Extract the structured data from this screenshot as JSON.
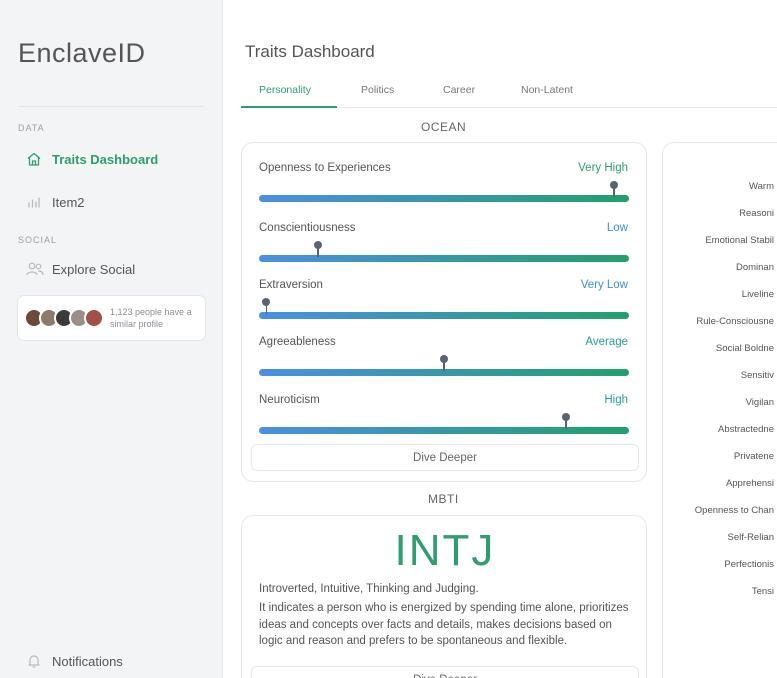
{
  "app": {
    "brand": "EnclaveID"
  },
  "sidebar": {
    "data_label": "DATA",
    "social_label": "SOCIAL",
    "items": [
      {
        "label": "Traits Dashboard",
        "icon": "home-icon"
      },
      {
        "label": "Item2",
        "icon": "bar-chart-icon"
      },
      {
        "label": "Explore Social",
        "icon": "people-icon"
      }
    ],
    "social_card": {
      "text": "1,123 people have a similar profile"
    },
    "notifications": {
      "label": "Notifications",
      "icon": "bell-icon"
    }
  },
  "header": {
    "title": "Traits Dashboard"
  },
  "tabs": [
    {
      "label": "Personality",
      "active": true
    },
    {
      "label": "Politics"
    },
    {
      "label": "Career"
    },
    {
      "label": "Non-Latent"
    }
  ],
  "ocean": {
    "title": "OCEAN",
    "traits": [
      {
        "name": "Openness to Experiences",
        "level": "Very High",
        "value": 0.96
      },
      {
        "name": "Conscientiousness",
        "level": "Low",
        "value": 0.16
      },
      {
        "name": "Extraversion",
        "level": "Very Low",
        "value": 0.02
      },
      {
        "name": "Agreeableness",
        "level": "Average",
        "value": 0.5
      },
      {
        "name": "Neuroticism",
        "level": "High",
        "value": 0.83
      }
    ],
    "button": "Dive Deeper"
  },
  "mbti": {
    "title": "MBTI",
    "type": "INTJ",
    "summary": "Introverted, Intuitive, Thinking and Judging.",
    "description": "It indicates a person who is energized by spending time alone, prioritizes ideas and concepts over facts and details, makes decisions based on logic and reason and prefers to be spontaneous and flexible.",
    "button": "Dive Deeper"
  },
  "factors": {
    "items": [
      "Warm",
      "Reasoni",
      "Emotional Stabil",
      "Dominan",
      "Liveline",
      "Rule-Consciousne",
      "Social Boldne",
      "Sensitiv",
      "Vigilan",
      "Abstractedne",
      "Privatene",
      "Apprehensi",
      "Openness to Chan",
      "Self-Relian",
      "Perfectionis",
      "Tensi"
    ]
  },
  "colors": {
    "accent": "#2e9e6f",
    "bar_start": "#4a90e2",
    "bar_end": "#22a06b"
  }
}
